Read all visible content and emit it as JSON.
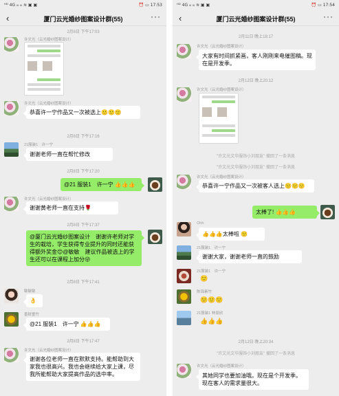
{
  "left": {
    "status": {
      "left": "ᴴᴰ 4G ᵢₗₗ ᵢₗₗ ≋ ▣ ▣",
      "right": "⏰ ▭ 17:53"
    },
    "title": "厦门云光婚纱图案设计群(55)",
    "ts1": "2月8日 下午17:03",
    "sender1": "许文光（云光婚纱图案设计）",
    "sender2": "许文光（云光婚纱图案设计）",
    "msg2": "恭喜许一宁作品又一次被选上🙂🙂🙂",
    "ts2": "2月8日 下午17:16",
    "sender3": "21服装1　许一宁",
    "msg3": "谢谢老师一直在帮忙修改",
    "ts3": "2月8日 下午17:20",
    "msg4": "@21 服装1　许一宁 👍👍👍",
    "sender5": "许文光（云光婚纱图案设计）",
    "msg5": "谢谢黄老师一直在支持🌹",
    "ts4": "2月8日 下午17:37",
    "msg6": "@厦门云光婚纱图案设计　谢谢许老师对学生的栽培，学生获得专业提升的同时还能获得额外奖金😊@敏敏　建议作品被选上的学生还可以在课程上加分😜",
    "ts5": "2月8日 下午17:41",
    "sender7": "敏敏敏",
    "msg7": "👌",
    "sender8": "善财童竹",
    "msg8": "@21 服装1　许一宁 👍👍👍",
    "ts6": "2月8日 下午17:47",
    "sender9": "许文光（云光婚纱图案设计）",
    "msg9": "谢谢各位老师一直在默默支持。能帮助到大家我也很高兴。我也会继续给大家上课，尽我所能帮助大家提高作品的选中率。"
  },
  "right": {
    "status": {
      "left": "ᴴᴰ 4G ᵢₗₗ ᵢₗₗ ≋ ▣ ▣",
      "right": "⏰ ▭ 17:54"
    },
    "title": "厦门云光婚纱图案设计群(55)",
    "ts1": "2月11日 晚上18:17",
    "sender1": "许文光（云光婚纱图案设计）",
    "msg1": "大家有时间抓紧画，客人刚刚来电催图稿。现在是开发季。",
    "ts2": "2月12日 晚上20:12",
    "sender2": "许文光（云光婚纱图案设计）",
    "sys1": "\"许文光文华服饰小刘朋友\" 撤回了一条消息",
    "sys2": "\"许文光文华服饰小刘朋友\" 撤回了一条消息",
    "sender3": "许文光（云光婚纱图案设计）",
    "msg3": "恭喜许一宁作品又一次被客人选上🙂🙂🙂",
    "msg4": "太棒了! 👍👍👍",
    "sender5": "Ohh",
    "msg5": "👍👍👍太棒啦 🙂",
    "sender6": "21服装1　许一宁",
    "msg6": "谢谢大家，谢谢老师一直的鼓励",
    "sender7": "21服装1　许一宁",
    "msg7": "🙂",
    "sender8": "陈锦素竹",
    "msg8": "🙂🙂🙂",
    "sender9": "21服装1 林丽欣",
    "msg9": "👍👍👍",
    "ts3": "2月12日 晚上20:34",
    "sys3": "\"许文光文华服饰小刘朋友\" 撤回了一条消息",
    "sender10": "许文光（云光婚纱图案设计）",
    "msg10": "其她同学也要加油哦。现在是个开发季。现在客人的需求量很大。"
  },
  "icons": {
    "back": "‹",
    "more": "···"
  }
}
